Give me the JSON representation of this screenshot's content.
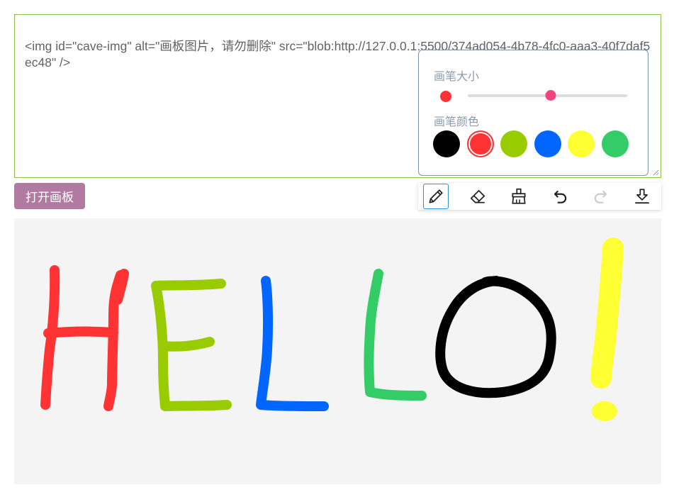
{
  "editor": {
    "code_text": "<img id=\"cave-img\" alt=\"画板图片，请勿删除\" src=\"blob:http://127.0.0.1:5500/374ad054-4b78-4fc0-aaa3-40f7daf5ec48\" />"
  },
  "pen_settings": {
    "size_label": "画笔大小",
    "color_label": "画笔颜色",
    "size_value_percent": 52,
    "current_color": "#ff3333",
    "slider_thumb_color": "#f0447c",
    "colors": [
      {
        "name": "black",
        "hex": "#000000",
        "selected": false
      },
      {
        "name": "red",
        "hex": "#ff3333",
        "selected": true
      },
      {
        "name": "yellow-green",
        "hex": "#99cc00",
        "selected": false
      },
      {
        "name": "blue",
        "hex": "#0066ff",
        "selected": false
      },
      {
        "name": "yellow",
        "hex": "#ffff33",
        "selected": false
      },
      {
        "name": "green",
        "hex": "#33cc66",
        "selected": false
      }
    ]
  },
  "actions": {
    "open_board_label": "打开画板",
    "open_board_color": "#b07aa1"
  },
  "toolbar": {
    "tools": [
      {
        "name": "pen",
        "icon": "pencil-icon",
        "active": true,
        "disabled": false
      },
      {
        "name": "eraser",
        "icon": "eraser-icon",
        "active": false,
        "disabled": false
      },
      {
        "name": "clear",
        "icon": "broom-icon",
        "active": false,
        "disabled": false
      },
      {
        "name": "undo",
        "icon": "undo-icon",
        "active": false,
        "disabled": false
      },
      {
        "name": "redo",
        "icon": "redo-icon",
        "active": false,
        "disabled": true
      },
      {
        "name": "download",
        "icon": "download-icon",
        "active": false,
        "disabled": false
      }
    ]
  },
  "drawing": {
    "background": "#f4f4f4",
    "letters": [
      {
        "char": "H",
        "color": "#ff3333"
      },
      {
        "char": "E",
        "color": "#99cc00"
      },
      {
        "char": "L",
        "color": "#0066ff"
      },
      {
        "char": "L",
        "color": "#33cc66"
      },
      {
        "char": "O",
        "color": "#000000"
      },
      {
        "char": "!",
        "color": "#ffff33"
      }
    ]
  }
}
